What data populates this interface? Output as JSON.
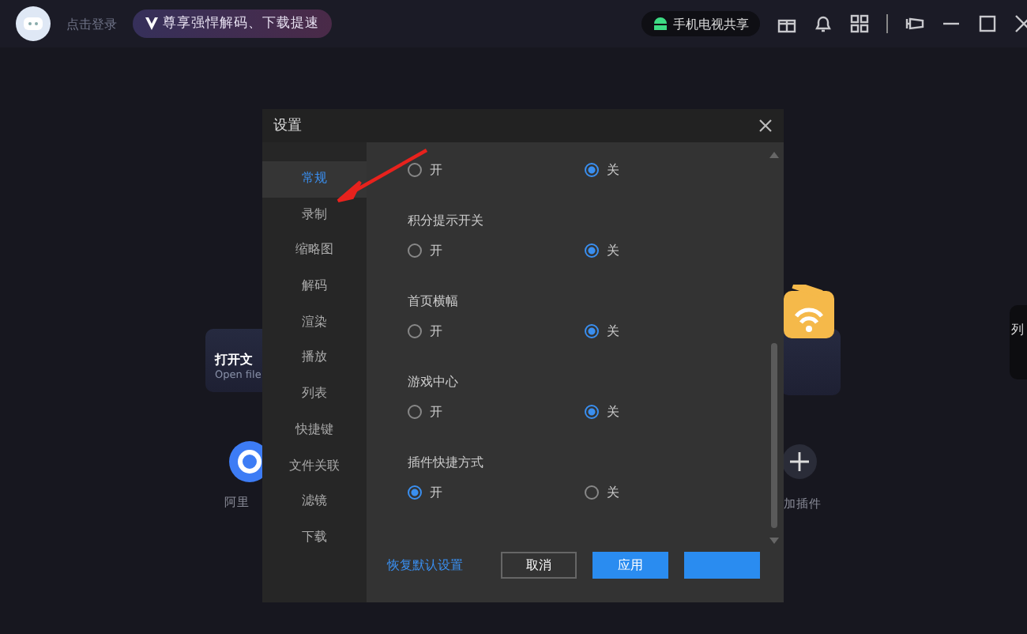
{
  "top_bar": {
    "login": "点击登录",
    "vip": "尊享强悍解码、下载提速",
    "share": "手机电视共享"
  },
  "home": {
    "open_file": {
      "title": "打开文",
      "subtitle": "Open file"
    },
    "cloud_label": "阿里",
    "plugin_label": "加插件",
    "side_card": "列"
  },
  "dialog": {
    "title": "设置",
    "sidebar": [
      {
        "label": "常规",
        "selected": true
      },
      {
        "label": "录制",
        "selected": false
      },
      {
        "label": "缩略图",
        "selected": false
      },
      {
        "label": "解码",
        "selected": false
      },
      {
        "label": "渲染",
        "selected": false
      },
      {
        "label": "播放",
        "selected": false
      },
      {
        "label": "列表",
        "selected": false
      },
      {
        "label": "快捷键",
        "selected": false
      },
      {
        "label": "文件关联",
        "selected": false
      },
      {
        "label": "滤镜",
        "selected": false
      },
      {
        "label": "下载",
        "selected": false
      }
    ],
    "settings": [
      {
        "options": [
          {
            "label": "开",
            "selected": false
          },
          {
            "label": "关",
            "selected": true
          }
        ]
      },
      {
        "label": "积分提示开关",
        "options": [
          {
            "label": "开",
            "selected": false
          },
          {
            "label": "关",
            "selected": true
          }
        ]
      },
      {
        "label": "首页横幅",
        "options": [
          {
            "label": "开",
            "selected": false
          },
          {
            "label": "关",
            "selected": true
          }
        ]
      },
      {
        "label": "游戏中心",
        "options": [
          {
            "label": "开",
            "selected": false
          },
          {
            "label": "关",
            "selected": true
          }
        ]
      },
      {
        "label": "插件快捷方式",
        "options": [
          {
            "label": "开",
            "selected": true
          },
          {
            "label": "关",
            "selected": false
          }
        ]
      }
    ],
    "reset": "恢复默认设置",
    "buttons": [
      {
        "label": "取消",
        "kind": "outline"
      },
      {
        "label": "应用",
        "kind": "primary"
      },
      {
        "kind": "primary"
      }
    ]
  }
}
